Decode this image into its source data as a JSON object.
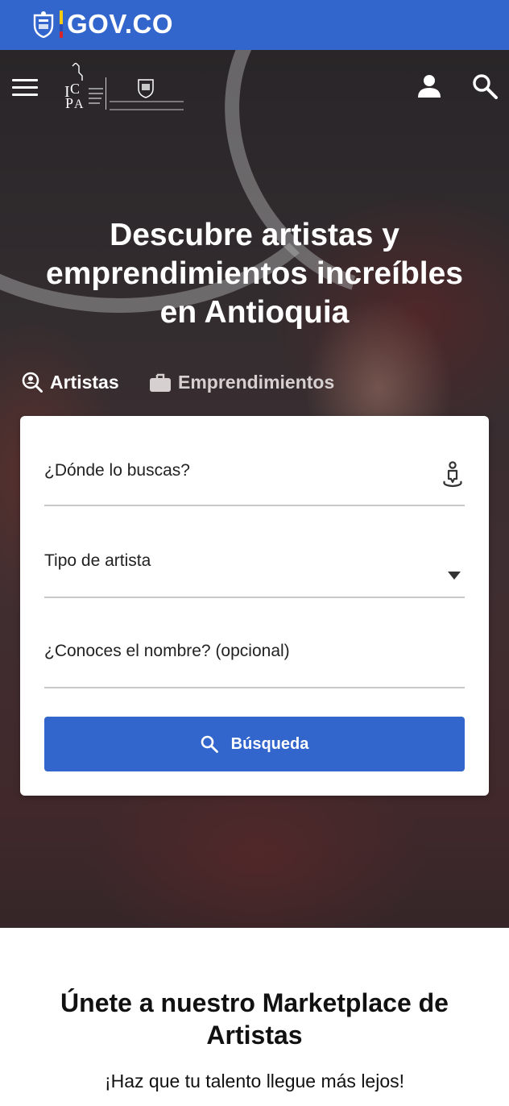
{
  "gov_bar": {
    "brand": "GOV.CO",
    "brand_color": "#3366cc"
  },
  "header": {
    "logo_primary_text": "ICPA",
    "logo_secondary_text": "GOBERNACIÓN DE ANTIOQUIA",
    "icons": [
      "menu-icon",
      "user-icon",
      "search-icon"
    ]
  },
  "hero": {
    "title_lines": [
      "Descubre artistas y",
      "emprendimientos increíbles",
      "en Antioquia"
    ],
    "tabs": [
      {
        "label": "Artistas",
        "icon": "search-person-icon",
        "active": true
      },
      {
        "label": "Emprendimientos",
        "icon": "briefcase-icon",
        "active": false
      }
    ]
  },
  "search_form": {
    "location_label": "¿Dónde lo buscas?",
    "artist_type_label": "Tipo de artista",
    "name_label": "¿Conoces el nombre? (opcional)",
    "submit_label": "Búsqueda",
    "accent": "#3366cc"
  },
  "join": {
    "title_lines": [
      "Únete a nuestro Marketplace de",
      "Artistas"
    ],
    "subtitle": "¡Haz que tu talento llegue más lejos!"
  }
}
